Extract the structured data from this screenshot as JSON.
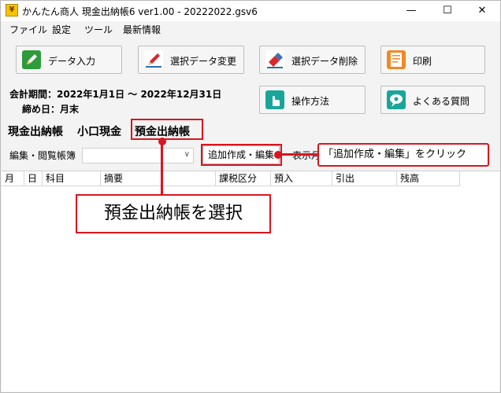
{
  "window": {
    "title": "かんたん商人 現金出納帳6 ver1.00 - 20222022.gsv6",
    "app_icon_glyph": "¥",
    "controls": {
      "minimize": "—",
      "maximize": "☐",
      "close": "✕"
    }
  },
  "menu": [
    "ファイル",
    "設定",
    "ツール",
    "最新情報"
  ],
  "toolbar": {
    "buttons": [
      {
        "label": "データ入力",
        "icon": "pencil-icon",
        "color": "#2e9b3c"
      },
      {
        "label": "選択データ変更",
        "icon": "pencil-icon",
        "color": "#1e6fb8"
      },
      {
        "label": "選択データ削除",
        "icon": "eraser-icon",
        "color": "#1e6fb8"
      },
      {
        "label": "印刷",
        "icon": "printer-icon",
        "color": "#f08a24"
      },
      {
        "label": "操作方法",
        "icon": "hand-icon",
        "color": "#1aa59a"
      },
      {
        "label": "よくある質問",
        "icon": "qa-icon",
        "color": "#1aa59a"
      }
    ]
  },
  "info": {
    "period": "会計期間：2022年1月1日 ～ 2022年12月31日",
    "closing": "締め日：月末"
  },
  "tabs": [
    "現金出納帳",
    "小口現金",
    "預金出納帳"
  ],
  "subbar": {
    "book_label": "編集・閲覧帳簿",
    "combo_value": "",
    "add_edit_button": "追加作成・編集",
    "display_label": "表示月"
  },
  "table": {
    "columns": [
      "月",
      "日",
      "科目",
      "摘要",
      "課税区分",
      "預入",
      "引出",
      "残高"
    ],
    "rows": []
  },
  "annotations": {
    "callout_top": "「追加作成・編集」をクリック",
    "callout_main": "預金出納帳を選択",
    "color": "#d9151e"
  }
}
